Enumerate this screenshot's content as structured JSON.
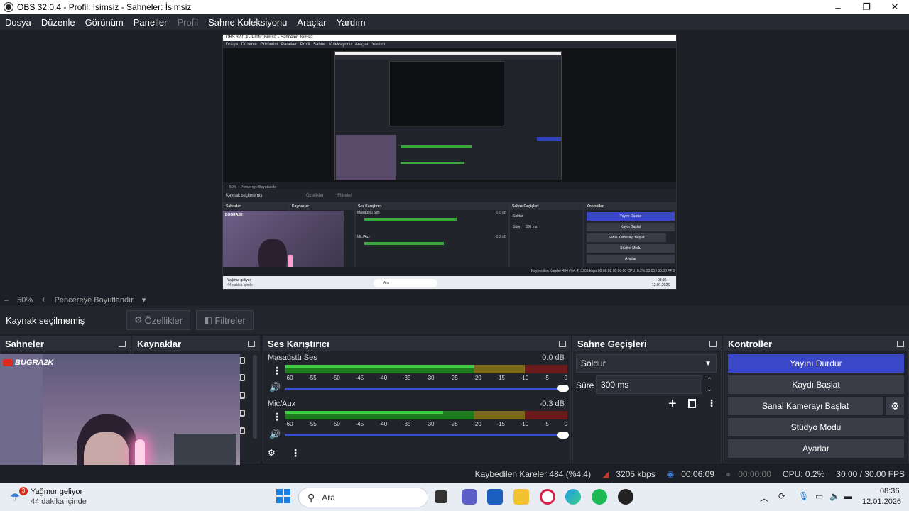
{
  "window": {
    "title": "OBS 32.0.4 - Profil: İsimsiz - Sahneler: İsimsiz",
    "minimize": "–",
    "maximize": "❐",
    "close": "✕"
  },
  "menu": [
    "Dosya",
    "Düzenle",
    "Görünüm",
    "Paneller",
    "Profil",
    "Sahne Koleksiyonu",
    "Araçlar",
    "Yardım"
  ],
  "nested": {
    "title": "OBS 32.0.4 - Profil: İsimsiz - Sahneler: İsimsiz",
    "menu": "Dosya Düzenle Görünüm Paneller Profil Sahne Koleksiyonu Araçlar Yardım",
    "zoom": "– 50% + Pencereye Boyutlandır",
    "source": "Kaynak seçilmemiş",
    "props": "Özellikler",
    "filters": "Filtreler",
    "scenes": "Sahneler",
    "sources": "Kaynaklar",
    "mixer": "Ses Karıştırıcı",
    "transitions": "Sahne Geçişleri",
    "controls": "Kontroller",
    "desktop": "Masaüstü Ses",
    "desktop_db": "0.0 dB",
    "mic": "Mic/Aux",
    "mic_db": "-0.3 dB",
    "fade": "Soldur",
    "duration": "Süre",
    "duration_val": "300 ms",
    "btn_stop": "Yayını Durdur",
    "btn_rec": "Kaydı Başlat",
    "btn_vcam": "Sanal Kamerayı Başlat",
    "btn_studio": "Stüdyo Modu",
    "btn_settings": "Ayarlar",
    "status": "Kaybedilen Kareler 484 (%4.4)   3205 kbps   00:06:09   00:00:00   CPU: 0.2%   30.00 / 30.00 FPS",
    "search": "Ara",
    "clock": "08:36",
    "date": "12.01.2026",
    "weather": "Yağmur geliyor",
    "weather_sub": "44 dakika içinde",
    "channel": "BUGRA2K"
  },
  "zoombar": {
    "minus": "–",
    "zoom": "50%",
    "plus": "+",
    "fit": "Pencereye Boyutlandır",
    "arrow": "▾"
  },
  "sourcebar": {
    "label": "Kaynak seçilmemiş",
    "properties": "Özellikler",
    "filters": "Filtreler"
  },
  "docks": {
    "scenes": "Sahneler",
    "sources": "Kaynaklar",
    "mixer": "Ses Karıştırıcı",
    "transitions": "Sahne Geçişleri",
    "controls": "Kontroller"
  },
  "channel_logo": "BUGRA2K",
  "mixer": {
    "tracks": [
      {
        "name": "Masaüstü Ses",
        "db": "0.0 dB",
        "level": 0.67
      },
      {
        "name": "Mic/Aux",
        "db": "-0.3 dB",
        "level": 0.56
      }
    ],
    "ticks": [
      "-60",
      "-55",
      "-50",
      "-45",
      "-40",
      "-35",
      "-30",
      "-25",
      "-20",
      "-15",
      "-10",
      "-5",
      "0"
    ]
  },
  "transitions": {
    "fade": "Soldur",
    "duration_label": "Süre",
    "duration": "300 ms"
  },
  "controls": {
    "stop_stream": "Yayını Durdur",
    "start_record": "Kaydı Başlat",
    "start_vcam": "Sanal Kamerayı Başlat",
    "studio_mode": "Stüdyo Modu",
    "settings": "Ayarlar"
  },
  "status": {
    "dropped": "Kaybedilen Kareler 484 (%4.4)",
    "bitrate": "3205 kbps",
    "stream_time": "00:06:09",
    "record_time": "00:00:00",
    "cpu": "CPU: 0.2%",
    "fps": "30.00 / 30.00 FPS"
  },
  "taskbar": {
    "weather": "Yağmur geliyor",
    "weather_sub": "44 dakika içinde",
    "weather_badge": "3",
    "search": "Ara",
    "time": "08:36",
    "date": "12.01.2026"
  },
  "colors": {
    "accent": "#3a47c7",
    "bg": "#1d1f26",
    "panel": "#22242b"
  }
}
